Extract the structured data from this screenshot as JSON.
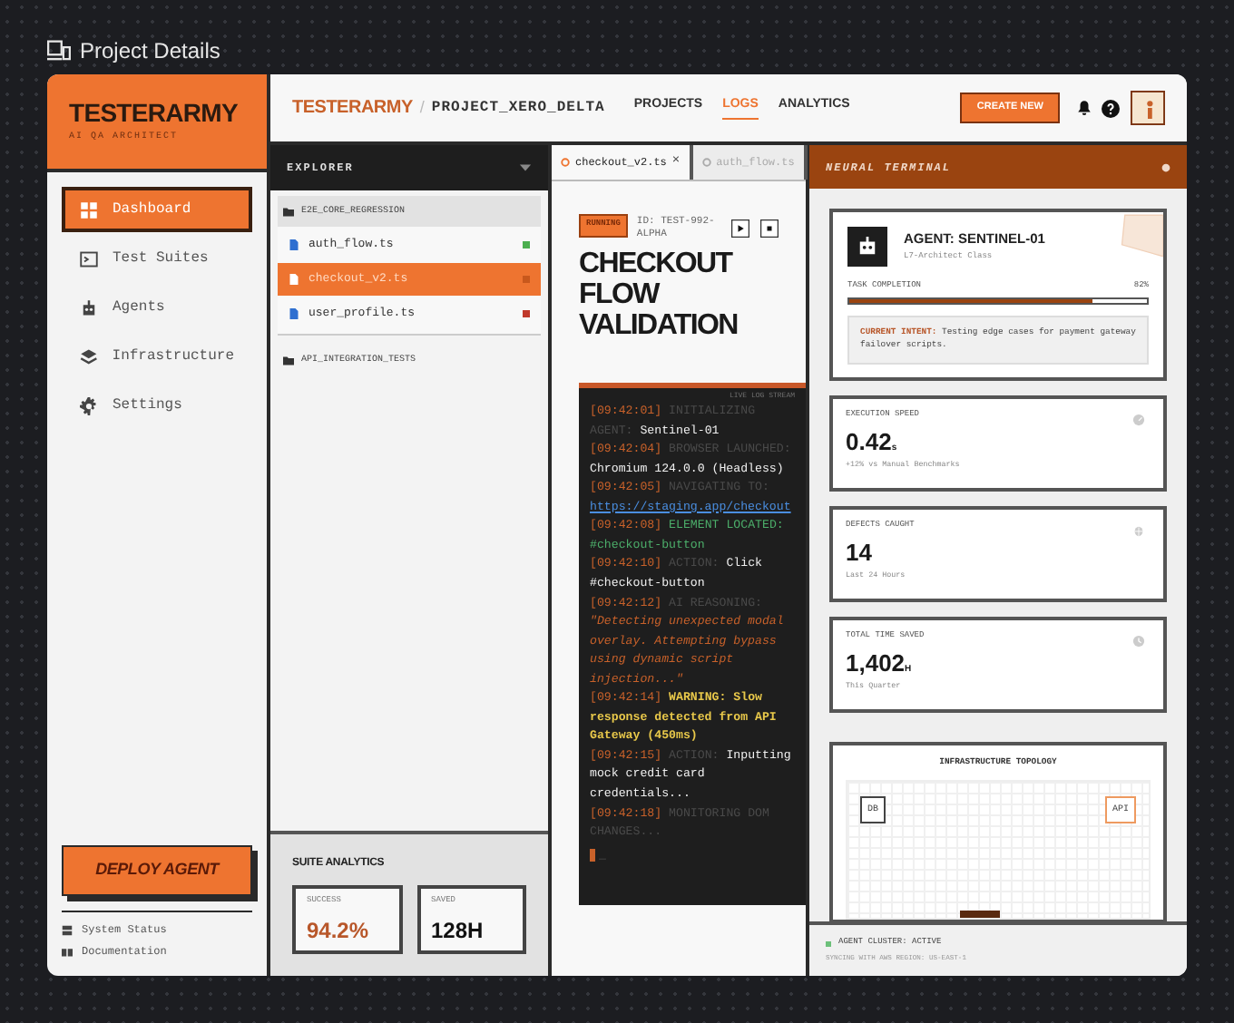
{
  "page_title": "Project Details",
  "sidebar": {
    "brand": "TESTERARMY",
    "tagline": "AI QA ARCHITECT",
    "items": [
      {
        "label": "Dashboard",
        "selected": true
      },
      {
        "label": "Test Suites",
        "selected": false
      },
      {
        "label": "Agents",
        "selected": false
      },
      {
        "label": "Infrastructure",
        "selected": false
      },
      {
        "label": "Settings",
        "selected": false
      }
    ],
    "deploy_button": "DEPLOY AGENT",
    "footer_links": [
      {
        "label": "System Status"
      },
      {
        "label": "Documentation"
      }
    ]
  },
  "topbar": {
    "brand": "TESTERARMY",
    "separator": "/",
    "project": "PROJECT_XERO_DELTA",
    "nav": [
      {
        "label": "PROJECTS",
        "selected": false
      },
      {
        "label": "LOGS",
        "selected": true
      },
      {
        "label": "ANALYTICS",
        "selected": false
      }
    ],
    "create_button": "CREATE NEW"
  },
  "explorer": {
    "title": "EXPLORER",
    "tree": [
      {
        "label": "E2E_CORE_REGRESSION",
        "expanded": true,
        "children": [
          {
            "label": "auth_flow.ts",
            "selected": false,
            "color": "#4caf50"
          },
          {
            "label": "checkout_v2.ts",
            "selected": true,
            "color": "#c8581c"
          },
          {
            "label": "user_profile.ts",
            "selected": false,
            "color": "#c0392b"
          }
        ]
      },
      {
        "label": "API_INTEGRATION_TESTS",
        "expanded": false
      }
    ],
    "analytics": {
      "title": "SUITE ANALYTICS",
      "stats": [
        {
          "label": "SUCCESS",
          "value": "94.2%",
          "kind": "accent"
        },
        {
          "label": "SAVED",
          "value": "128H",
          "kind": "plain"
        }
      ]
    }
  },
  "editor": {
    "tabs": [
      {
        "label": "checkout_v2.ts",
        "selected": true,
        "close": "×"
      },
      {
        "label": "auth_flow.ts",
        "selected": false
      }
    ],
    "status": "RUNNING",
    "test_id": "ID: TEST-992-ALPHA",
    "title": "CHECKOUT FLOW VALIDATION",
    "log_header": "LIVE LOG STREAM",
    "log": [
      {
        "time": "[09:42:01]",
        "tag": "INITIALIZING AGENT:",
        "text": "Sentinel-01",
        "kind": "info"
      },
      {
        "time": "[09:42:04]",
        "tag": "BROWSER LAUNCHED:",
        "text": "Chromium 124.0.0 (Headless)",
        "kind": "info"
      },
      {
        "time": "[09:42:05]",
        "tag": "NAVIGATING TO:",
        "text": "https://staging.app/checkout",
        "kind": "link"
      },
      {
        "time": "[09:42:08]",
        "tag": "ELEMENT LOCATED:",
        "text": "#checkout-button",
        "kind": "success"
      },
      {
        "time": "[09:42:10]",
        "tag": "ACTION:",
        "text": "Click #checkout-button",
        "kind": "info"
      },
      {
        "time": "[09:42:12]",
        "tag": "AI REASONING:",
        "text": "\"Detecting unexpected modal overlay. Attempting bypass using dynamic script injection...\"",
        "kind": "reasoning"
      },
      {
        "time": "[09:42:14]",
        "tag": "WARNING:",
        "text": "Slow response detected from API Gateway (450ms)",
        "kind": "warning"
      },
      {
        "time": "[09:42:15]",
        "tag": "ACTION:",
        "text": "Inputting mock credit card credentials...",
        "kind": "info"
      },
      {
        "time": "[09:42:18]",
        "tag": "MONITORING DOM CHANGES...",
        "kind": "info"
      }
    ],
    "cursor": "_"
  },
  "terminal": {
    "title": "NEURAL TERMINAL",
    "agent": {
      "name": "AGENT: SENTINEL-01",
      "class": "L7-Architect Class",
      "progress_label": "TASK COMPLETION",
      "progress_reading": "82%",
      "level": 0.82,
      "intent_label": "CURRENT INTENT:",
      "intent": "Testing edge cases for payment gateway failover scripts."
    },
    "metrics": [
      {
        "label": "EXECUTION SPEED",
        "value": "0.42",
        "unit": "s",
        "note": "+12% vs Manual Benchmarks"
      },
      {
        "label": "DEFECTS CAUGHT",
        "value": "14",
        "note": "Last 24 Hours"
      },
      {
        "label": "TOTAL TIME SAVED",
        "value": "1,402",
        "unit": "H",
        "note": "This Quarter"
      }
    ],
    "topology": {
      "title": "INFRASTRUCTURE TOPOLOGY",
      "nodes": [
        {
          "label": "DB",
          "kind": "plain"
        },
        {
          "label": "API",
          "kind": "accent"
        }
      ]
    },
    "status": {
      "label": "AGENT CLUSTER: ACTIVE",
      "detail": "SYNCING WITH AWS REGION: US-EAST-1",
      "active": true
    }
  }
}
